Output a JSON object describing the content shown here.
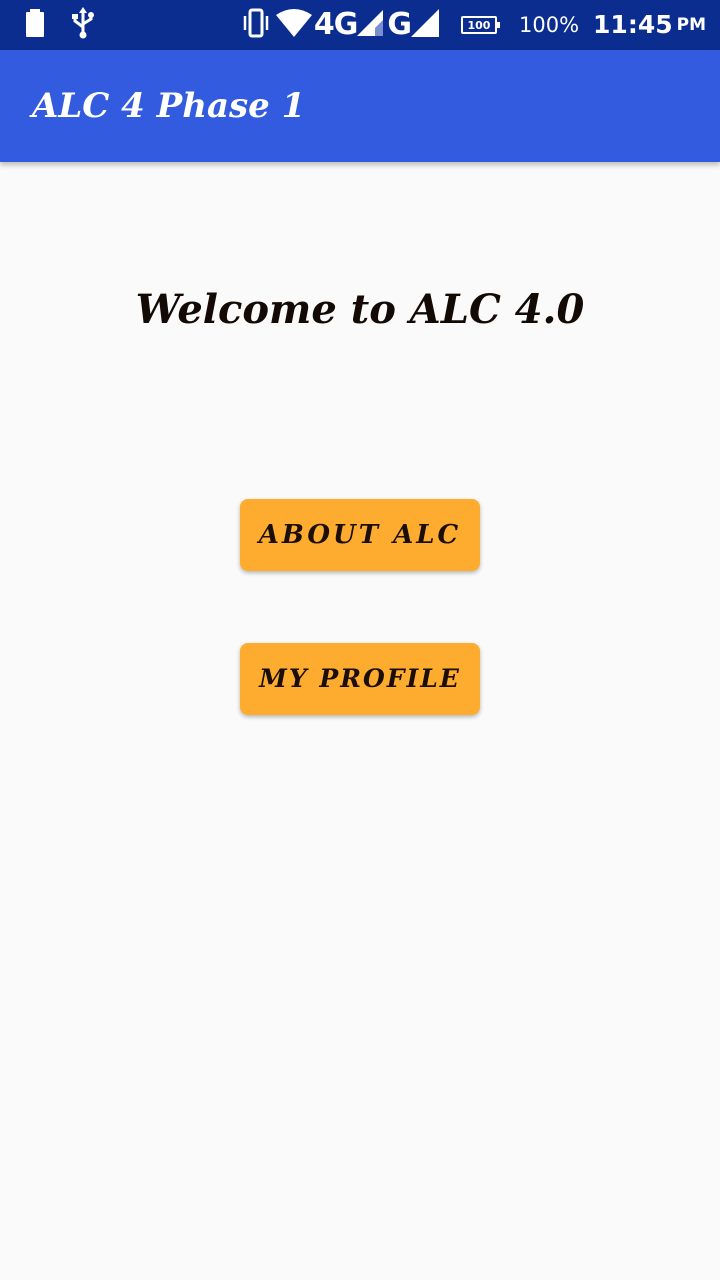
{
  "status_bar": {
    "network_label": "4G",
    "network_secondary_label": "G",
    "battery_icon_level": "100",
    "battery_percent": "100%",
    "time": "11:45",
    "time_suffix": "PM",
    "icons": [
      "battery-saver-icon",
      "usb-icon",
      "vibrate-icon",
      "wifi-icon",
      "signal-icon",
      "signal-icon",
      "battery-icon"
    ],
    "background_color": "#0a2d8f"
  },
  "app_bar": {
    "title": "ALC 4 Phase 1",
    "background_color": "#335bdf"
  },
  "main": {
    "welcome_text": "Welcome to ALC 4.0",
    "buttons": [
      {
        "label": "ABOUT ALC"
      },
      {
        "label": "MY PROFILE"
      }
    ],
    "button_color": "#fdac30",
    "background_color": "#fafafa"
  }
}
